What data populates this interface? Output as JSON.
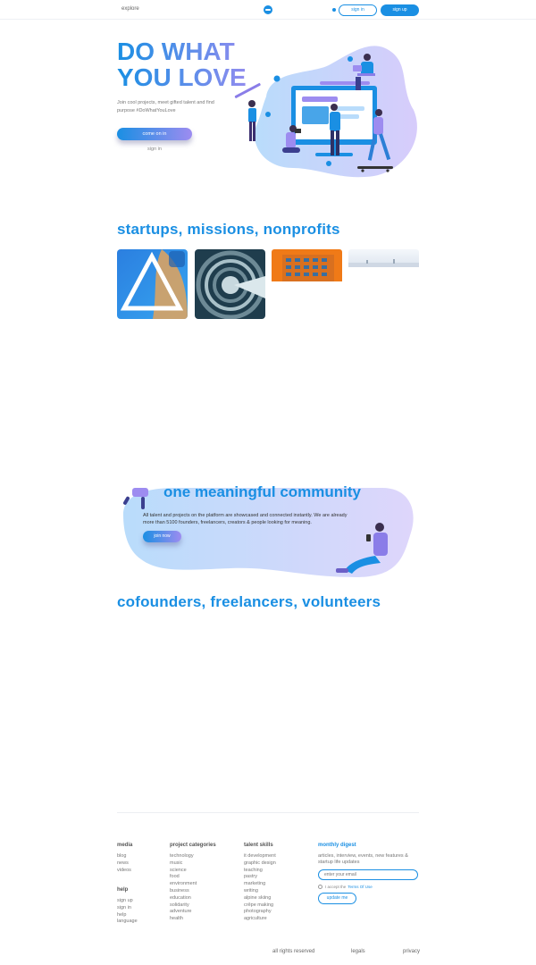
{
  "header": {
    "explore_label": "explore",
    "signin_label": "sign in",
    "signup_label": "sign up"
  },
  "hero": {
    "title_line1": "DO WHAT",
    "title_line2": "YOU LOVE",
    "subtitle": "Join cool projects, meet gifted talent and find purpose #DoWhatYouLove",
    "cta_label": "come on in",
    "signin_label": "sign in"
  },
  "startups": {
    "heading": "startups, missions, nonprofits"
  },
  "community": {
    "heading": "one meaningful community",
    "text": "All talent and projects on the platform are showcased and connected instantly. We are already more than 5100 founders, freelancers, creators & people looking for meaning.",
    "join_label": "join now"
  },
  "talent": {
    "heading": "cofounders, freelancers, volunteers"
  },
  "footer": {
    "media": {
      "heading": "media",
      "items": [
        "blog",
        "news",
        "videos"
      ]
    },
    "help": {
      "heading": "help",
      "items": [
        "sign up",
        "sign in",
        "help",
        "language"
      ]
    },
    "categories": {
      "heading": "project categories",
      "items": [
        "technology",
        "music",
        "science",
        "food",
        "environment",
        "business",
        "education",
        "solidarity",
        "adventure",
        "health"
      ]
    },
    "skills": {
      "heading": "talent skills",
      "items": [
        "it development",
        "graphic design",
        "teaching",
        "pastry",
        "marketing",
        "writing",
        "alpine skiing",
        "crêpe making",
        "photography",
        "agriculture"
      ]
    },
    "digest": {
      "heading": "monthly digest",
      "text": "articles, interview, events, new features & startup life updates",
      "email_placeholder": "enter your email",
      "terms_text": "I accept the",
      "terms_link": "Terms Of Use",
      "update_label": "update me"
    },
    "bottom": {
      "rights": "all rights reserved",
      "legals": "legals",
      "privacy": "privacy"
    }
  },
  "colors": {
    "brand_blue": "#1a8fe3",
    "brand_purple": "#9d8cf0"
  }
}
